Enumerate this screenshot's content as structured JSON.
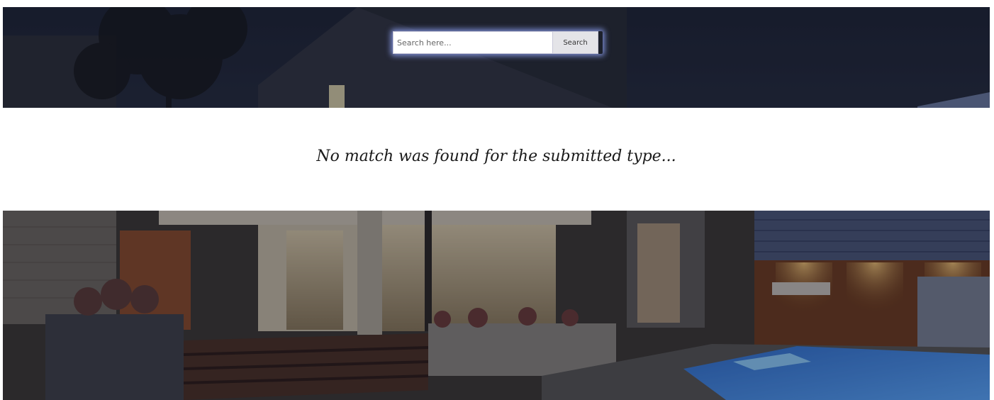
{
  "search": {
    "placeholder": "Search here...",
    "button_label": "Search"
  },
  "results": {
    "message": "No match was found for the submitted type..."
  }
}
